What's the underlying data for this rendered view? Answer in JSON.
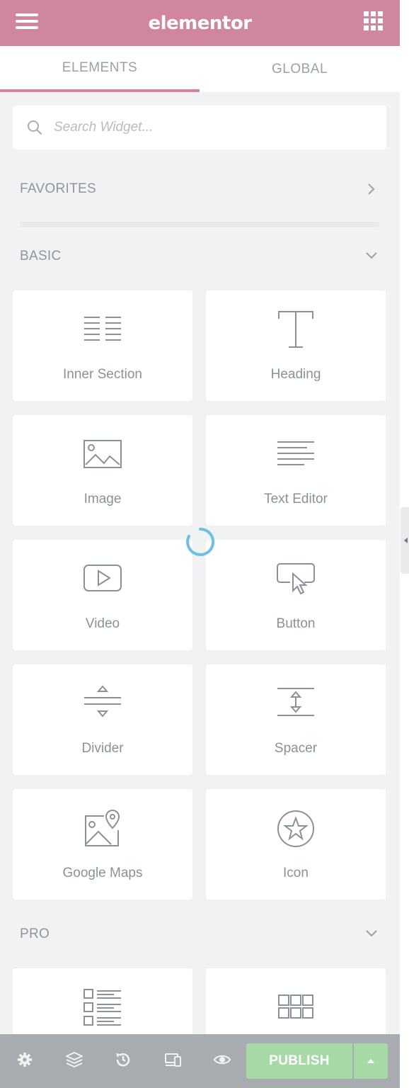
{
  "header": {
    "logo": "elementor"
  },
  "tabs": [
    {
      "label": "ELEMENTS"
    },
    {
      "label": "GLOBAL"
    }
  ],
  "search": {
    "placeholder": "Search Widget..."
  },
  "categories": {
    "favorites": {
      "title": "FAVORITES"
    },
    "basic": {
      "title": "BASIC"
    },
    "pro": {
      "title": "PRO"
    }
  },
  "widgets": [
    {
      "label": "Inner Section",
      "icon": "inner-section-icon"
    },
    {
      "label": "Heading",
      "icon": "heading-icon"
    },
    {
      "label": "Image",
      "icon": "image-icon"
    },
    {
      "label": "Text Editor",
      "icon": "text-editor-icon"
    },
    {
      "label": "Video",
      "icon": "video-icon"
    },
    {
      "label": "Button",
      "icon": "button-icon"
    },
    {
      "label": "Divider",
      "icon": "divider-icon"
    },
    {
      "label": "Spacer",
      "icon": "spacer-icon"
    },
    {
      "label": "Google Maps",
      "icon": "google-maps-icon"
    },
    {
      "label": "Icon",
      "icon": "star-icon"
    }
  ],
  "pro_widgets": [
    {
      "icon": "posts-icon"
    },
    {
      "icon": "portfolio-icon"
    }
  ],
  "footer": {
    "publish_label": "PUBLISH"
  },
  "colors": {
    "header_bg": "#d0869d",
    "tab_active_border": "#d0869d",
    "panel_bg": "#f1f2f4",
    "publish_bg": "#a6d9a6",
    "footer_bg": "#a8acb0",
    "spinner": "#6ec1e4"
  }
}
